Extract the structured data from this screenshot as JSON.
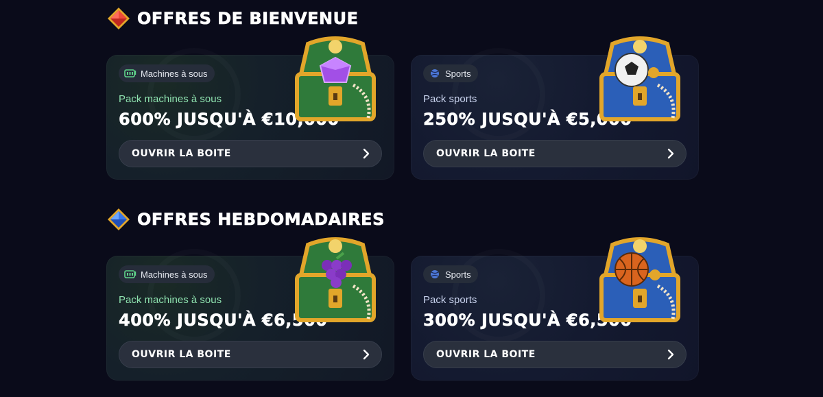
{
  "sections": [
    {
      "title": "OFFRES DE BIENVENUE",
      "gem_color": "#e0322d"
    },
    {
      "title": "OFFRES HEBDOMADAIRES",
      "gem_color": "#2f6fe0"
    }
  ],
  "cards": [
    {
      "badge": "Machines à sous",
      "badge_icon": "slot-machine-icon",
      "pack": "Pack machines à sous",
      "offer": "600% JUSQU'À €10,000",
      "button": "OUVRIR LA BOITE",
      "chest_item": "purple-gem"
    },
    {
      "badge": "Sports",
      "badge_icon": "sports-ball-icon",
      "pack": "Pack sports",
      "offer": "250% JUSQU'À €5,000",
      "button": "OUVRIR LA BOITE",
      "chest_item": "soccer-ball"
    },
    {
      "badge": "Machines à sous",
      "badge_icon": "slot-machine-icon",
      "pack": "Pack machines à sous",
      "offer": "400% JUSQU'À €6,500",
      "button": "OUVRIR LA BOITE",
      "chest_item": "grapes"
    },
    {
      "badge": "Sports",
      "badge_icon": "sports-ball-icon",
      "pack": "Pack sports",
      "offer": "300% JUSQU'À €6,500",
      "button": "OUVRIR LA BOITE",
      "chest_item": "basketball"
    }
  ],
  "colors": {
    "background": "#0a0b1a",
    "slots_accent": "#8fe3b0",
    "chest_green": "#2f7a3a",
    "chest_blue": "#2b5fb8",
    "gold": "#e2a62a"
  }
}
